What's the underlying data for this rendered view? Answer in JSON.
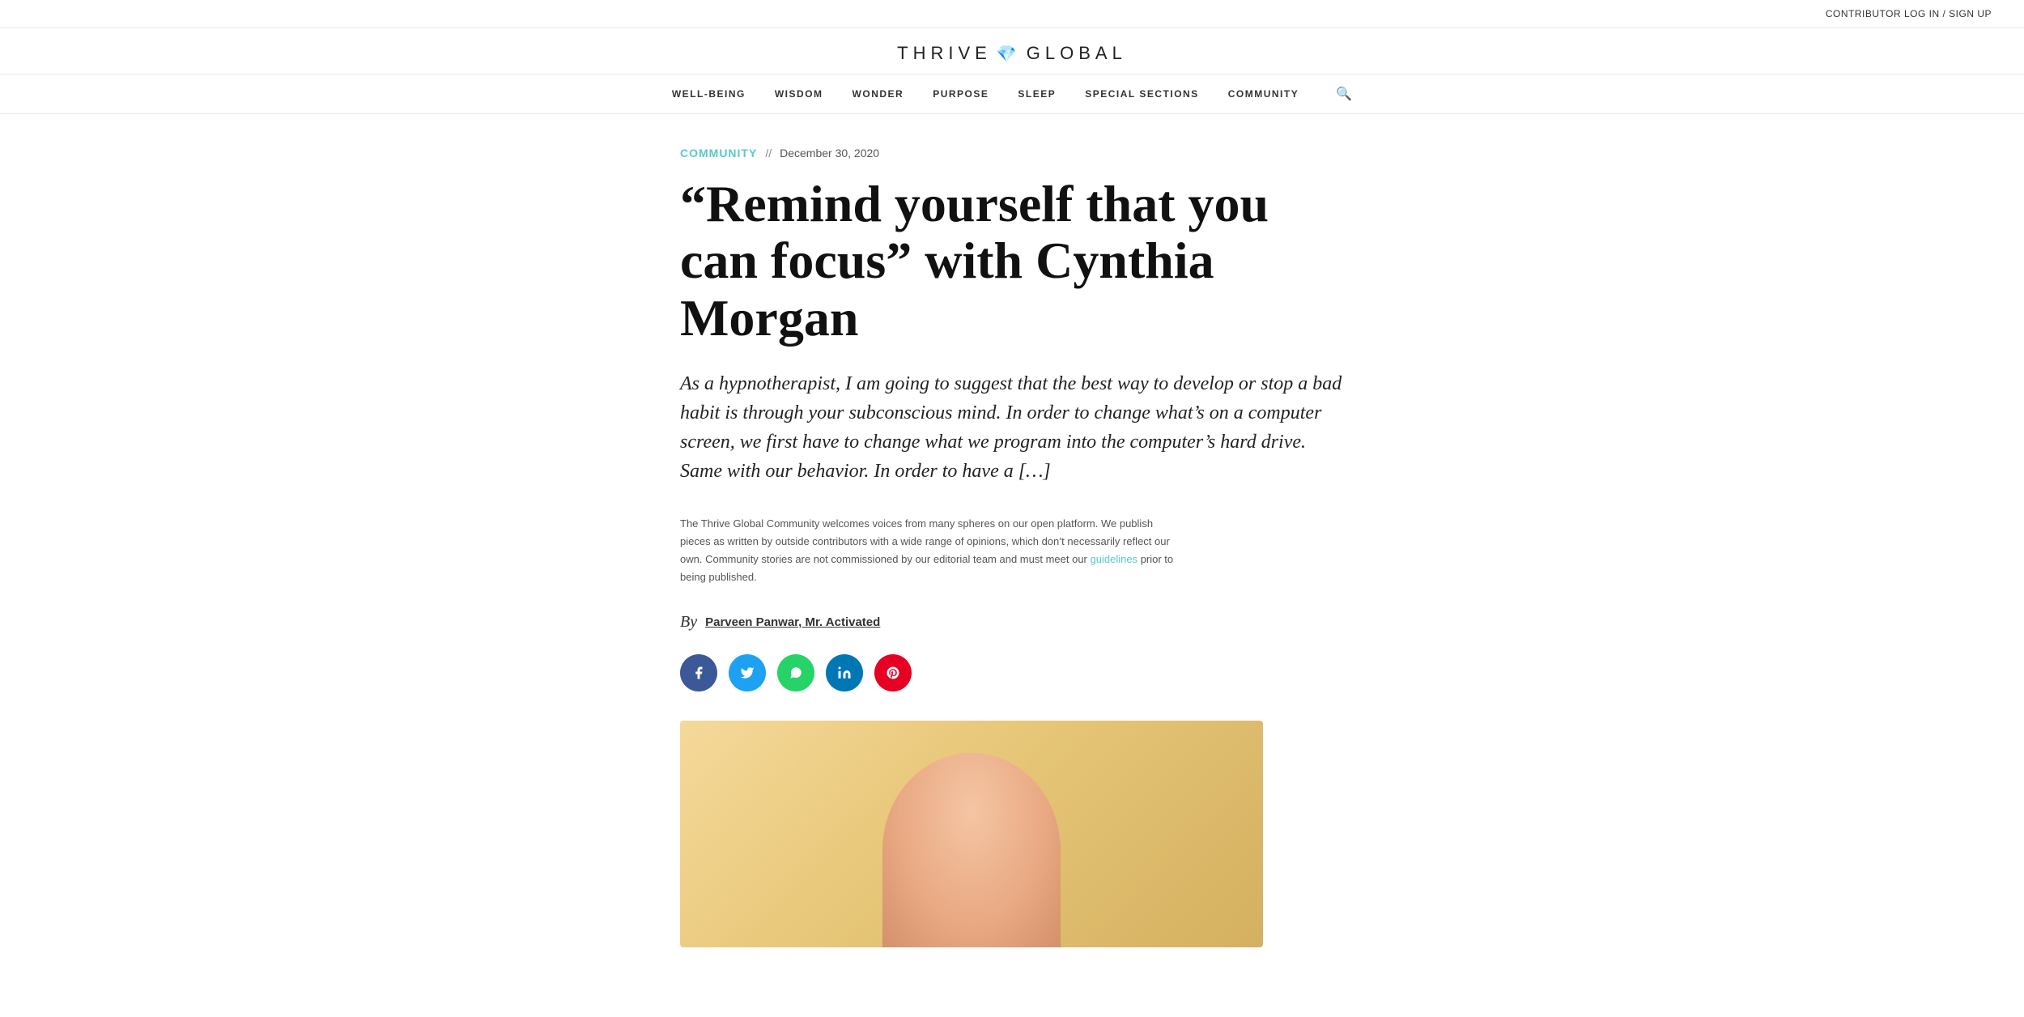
{
  "topbar": {
    "links": "CONTRIBUTOR LOG IN / SIGN UP"
  },
  "logo": {
    "part1": "THRIVE",
    "diamond": "💎",
    "part2": "GLOBAL"
  },
  "nav": {
    "items": [
      {
        "label": "WELL-BEING",
        "id": "wellbeing"
      },
      {
        "label": "WISDOM",
        "id": "wisdom"
      },
      {
        "label": "WONDER",
        "id": "wonder"
      },
      {
        "label": "PURPOSE",
        "id": "purpose"
      },
      {
        "label": "SLEEP",
        "id": "sleep"
      },
      {
        "label": "SPECIAL SECTIONS",
        "id": "special"
      },
      {
        "label": "COMMUNITY",
        "id": "community"
      }
    ]
  },
  "article": {
    "category": "COMMUNITY",
    "separator": "//",
    "date": "December 30, 2020",
    "title": "“Remind yourself that you can focus” with Cynthia Morgan",
    "subtitle": "As a hypnotherapist, I am going to suggest that the best way to develop or stop a bad habit is through your subconscious mind. In order to change what’s on a computer screen, we first have to change what we program into the computer’s hard drive. Same with our behavior. In order to have a […]",
    "disclaimer": "The Thrive Global Community welcomes voices from many spheres on our open platform. We publish pieces as written by outside contributors with a wide range of opinions, which don’t necessarily reflect our own. Community stories are not commissioned by our editorial team and must meet our",
    "disclaimer_link_text": "guidelines",
    "disclaimer_suffix": " prior to being published.",
    "author_by": "By",
    "author_name": "Parveen Panwar, Mr. Activated"
  },
  "social": {
    "facebook_label": "f",
    "twitter_label": "t",
    "whatsapp_label": "w",
    "linkedin_label": "in",
    "pinterest_label": "p"
  }
}
